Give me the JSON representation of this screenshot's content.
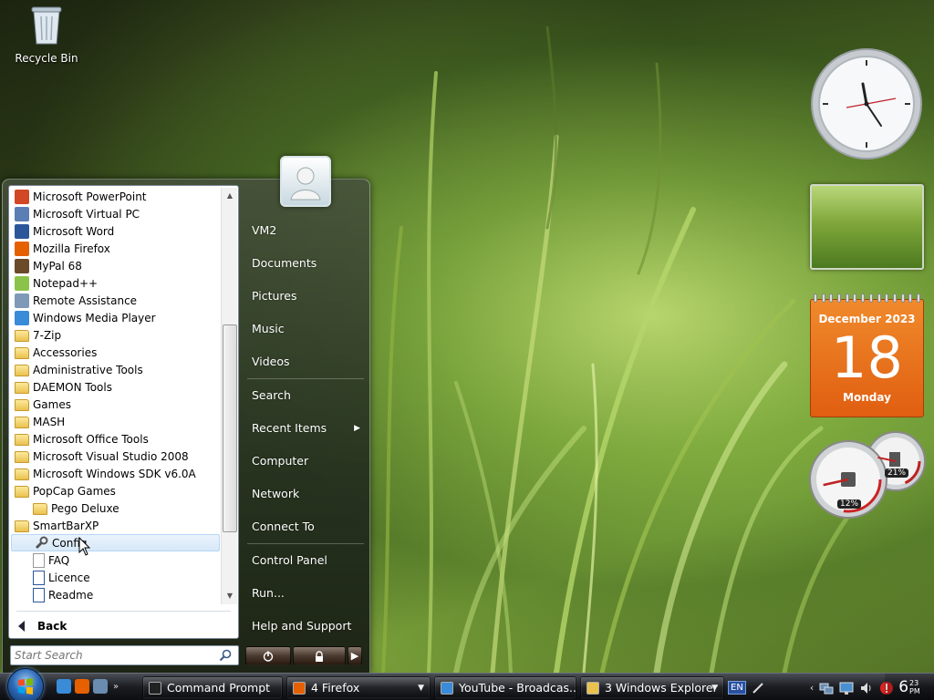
{
  "desktop": {
    "icons": [
      {
        "label": "Recycle Bin",
        "icon": "recycle-bin-icon"
      }
    ]
  },
  "start_menu": {
    "programs": [
      {
        "label": "Microsoft PowerPoint",
        "icon": "powerpoint-icon",
        "color": "#d24726",
        "level": 0
      },
      {
        "label": "Microsoft Virtual PC",
        "icon": "virtual-pc-icon",
        "color": "#5b7fb5",
        "level": 0
      },
      {
        "label": "Microsoft Word",
        "icon": "word-icon",
        "color": "#2b579a",
        "level": 0
      },
      {
        "label": "Mozilla Firefox",
        "icon": "firefox-icon",
        "color": "#e66000",
        "level": 0
      },
      {
        "label": "MyPal 68",
        "icon": "mypal-icon",
        "color": "#6b4a2a",
        "level": 0
      },
      {
        "label": "Notepad++",
        "icon": "notepadpp-icon",
        "color": "#8bc34a",
        "level": 0
      },
      {
        "label": "Remote Assistance",
        "icon": "remote-assistance-icon",
        "color": "#7e9ab8",
        "level": 0
      },
      {
        "label": "Windows Media Player",
        "icon": "media-player-icon",
        "color": "#3a8bd8",
        "level": 0
      },
      {
        "label": "7-Zip",
        "icon": "folder-icon",
        "level": 0
      },
      {
        "label": "Accessories",
        "icon": "folder-icon",
        "level": 0
      },
      {
        "label": "Administrative Tools",
        "icon": "folder-icon",
        "level": 0
      },
      {
        "label": "DAEMON Tools",
        "icon": "folder-icon",
        "level": 0
      },
      {
        "label": "Games",
        "icon": "folder-icon",
        "level": 0
      },
      {
        "label": "MASH",
        "icon": "folder-icon",
        "level": 0
      },
      {
        "label": "Microsoft Office Tools",
        "icon": "folder-icon",
        "level": 0
      },
      {
        "label": "Microsoft Visual Studio 2008",
        "icon": "folder-icon",
        "level": 0
      },
      {
        "label": "Microsoft Windows SDK v6.0A",
        "icon": "folder-icon",
        "level": 0
      },
      {
        "label": "PopCap Games",
        "icon": "folder-icon",
        "level": 0
      },
      {
        "label": "Pego Deluxe",
        "icon": "folder-icon",
        "level": 1
      },
      {
        "label": "SmartBarXP",
        "icon": "folder-icon",
        "level": 0
      },
      {
        "label": "Config",
        "icon": "wrench-icon",
        "level": 1,
        "highlighted": true
      },
      {
        "label": "FAQ",
        "icon": "document-icon",
        "level": 1
      },
      {
        "label": "Licence",
        "icon": "word-doc-icon",
        "level": 1
      },
      {
        "label": "Readme",
        "icon": "word-doc-icon",
        "level": 1
      }
    ],
    "back_label": "Back",
    "search_placeholder": "Start Search",
    "right_links": [
      {
        "label": "VM2",
        "separator_after": false
      },
      {
        "label": "Documents",
        "separator_after": false
      },
      {
        "label": "Pictures",
        "separator_after": false
      },
      {
        "label": "Music",
        "separator_after": false
      },
      {
        "label": "Videos",
        "separator_after": true
      },
      {
        "label": "Search",
        "separator_after": false
      },
      {
        "label": "Recent Items",
        "submenu": true,
        "separator_after": false
      },
      {
        "label": "Computer",
        "separator_after": false
      },
      {
        "label": "Network",
        "separator_after": false
      },
      {
        "label": "Connect To",
        "separator_after": true
      },
      {
        "label": "Control Panel",
        "separator_after": false
      },
      {
        "label": "Run...",
        "separator_after": false
      },
      {
        "label": "Help and Support",
        "separator_after": false
      }
    ],
    "power_buttons": [
      {
        "icon": "power-icon"
      },
      {
        "icon": "lock-icon"
      },
      {
        "icon": "arrow-right-icon"
      }
    ]
  },
  "gadgets": {
    "calendar": {
      "month": "December 2023",
      "day": "18",
      "weekday": "Monday",
      "color": "#e8701a"
    },
    "cpu_meter": {
      "cpu_label": "12%",
      "ram_label": "21%",
      "cpu": 12,
      "ram": 21
    }
  },
  "taskbar": {
    "quick_launch": [
      {
        "icon": "ie-icon",
        "color": "#3a8bd8"
      },
      {
        "icon": "firefox-icon",
        "color": "#e66000"
      },
      {
        "icon": "show-desktop-icon",
        "color": "#6a8cb0"
      }
    ],
    "buttons": [
      {
        "label": "Command Prompt",
        "icon": "cmd-icon",
        "dropdown": false
      },
      {
        "label": "4 Firefox",
        "icon": "firefox-icon",
        "dropdown": true
      },
      {
        "label": "YouTube - Broadcas...",
        "icon": "ie-icon",
        "dropdown": false
      },
      {
        "label": "3 Windows Explorer",
        "icon": "folder-icon",
        "dropdown": true
      }
    ],
    "tray": {
      "language": "EN",
      "time_hour": "6",
      "time_min": "23",
      "time_ampm": "PM"
    }
  }
}
